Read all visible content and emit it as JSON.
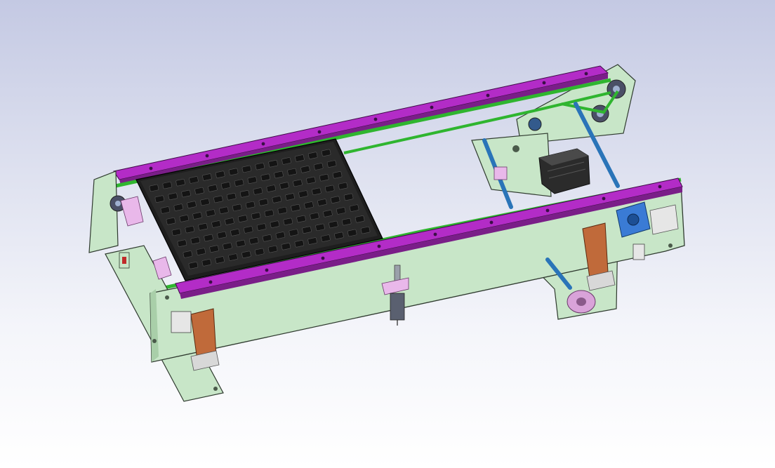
{
  "viewport": {
    "background_top": "#c4c9e3",
    "background_bottom": "#ffffff"
  },
  "model": {
    "colors": {
      "frame": "#c8e6c8",
      "frame_outline": "#2f3a2f",
      "rail": "#b32cc7",
      "belt": "#2fb52f",
      "tray": "#1e1e1e",
      "shaft": "#2a74b8",
      "motor": "#2b2b2b",
      "bracket": "#c06a3a",
      "bearing": "#3a7bd5",
      "pulley": "#d9a3d9",
      "clip": "#e9b8ea"
    },
    "components": [
      "side-frame-near",
      "side-frame-far",
      "conveyor-rail-near",
      "conveyor-rail-far",
      "timing-belt",
      "part-tray",
      "drive-shaft",
      "stepper-motor",
      "guide-bracket",
      "bearing-block",
      "sensor-probe",
      "pulley"
    ]
  }
}
